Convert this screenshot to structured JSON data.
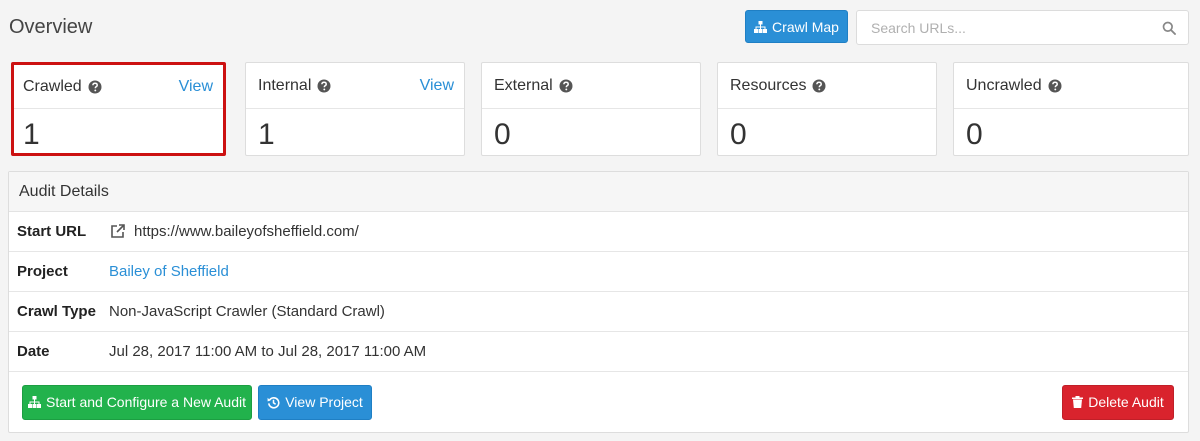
{
  "header": {
    "title": "Overview",
    "crawl_map_label": "Crawl Map",
    "search_placeholder": "Search URLs..."
  },
  "stats": [
    {
      "label": "Crawled",
      "value": "1",
      "view": "View"
    },
    {
      "label": "Internal",
      "value": "1",
      "view": "View"
    },
    {
      "label": "External",
      "value": "0"
    },
    {
      "label": "Resources",
      "value": "0"
    },
    {
      "label": "Uncrawled",
      "value": "0"
    }
  ],
  "audit": {
    "heading": "Audit Details",
    "rows": [
      {
        "label": "Start URL",
        "value": "https://www.baileyofsheffield.com/"
      },
      {
        "label": "Project",
        "value": "Bailey of Sheffield"
      },
      {
        "label": "Crawl Type",
        "value": "Non-JavaScript Crawler (Standard Crawl)"
      },
      {
        "label": "Date",
        "value": "Jul 28, 2017 11:00 AM to Jul 28, 2017 11:00 AM"
      }
    ]
  },
  "footer": {
    "start_label": "Start and Configure a New Audit",
    "view_project_label": "View Project",
    "delete_label": "Delete Audit"
  },
  "colors": {
    "primary": "#2a8fd6",
    "success": "#22b24c",
    "danger": "#d9232d",
    "highlight": "#cc1111"
  },
  "icons": {
    "crawl_map": "sitemap-icon",
    "search": "search-icon",
    "help": "question-circle-icon",
    "start_url": "external-link-icon",
    "start_audit": "sitemap-icon",
    "view_project": "history-icon",
    "delete": "trash-icon"
  }
}
